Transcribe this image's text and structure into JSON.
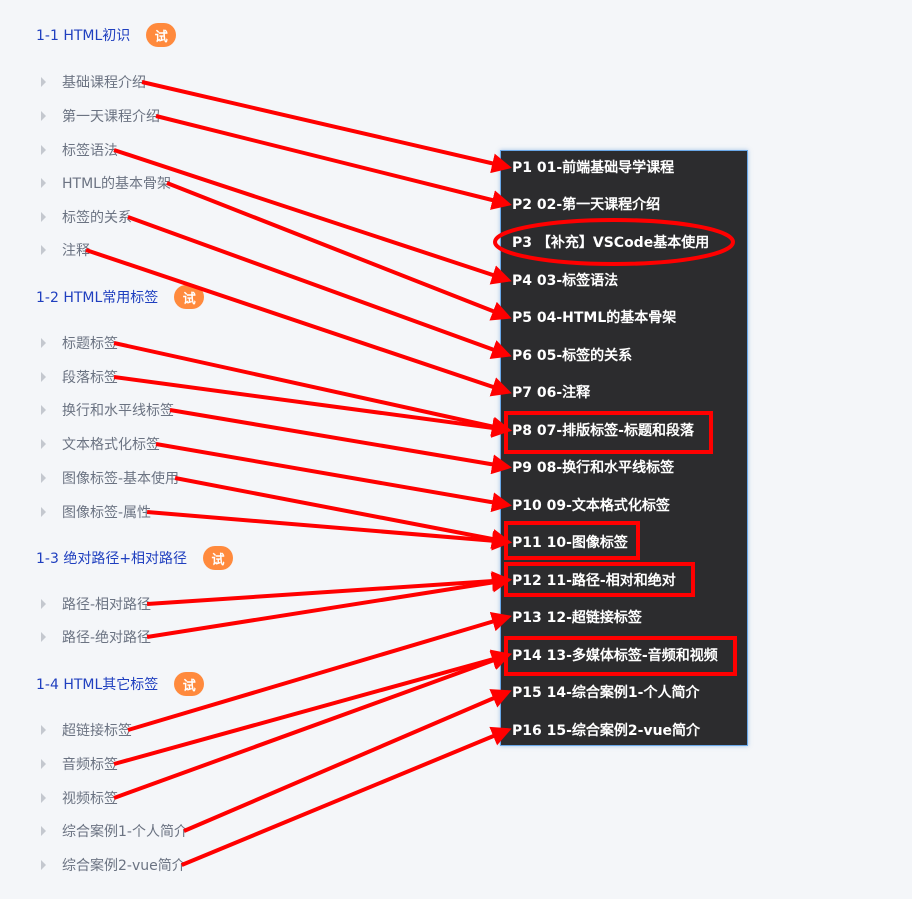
{
  "course_outline": {
    "trial_badge_label": "试",
    "sections": [
      {
        "title": "1-1 HTML初识",
        "lessons": [
          "基础课程介绍",
          "第一天课程介绍",
          "标签语法",
          "HTML的基本骨架",
          "标签的关系",
          "注释"
        ]
      },
      {
        "title": "1-2 HTML常用标签",
        "lessons": [
          "标题标签",
          "段落标签",
          "换行和水平线标签",
          "文本格式化标签",
          "图像标签-基本使用",
          "图像标签-属性"
        ]
      },
      {
        "title": "1-3 绝对路径+相对路径",
        "lessons": [
          "路径-相对路径",
          "路径-绝对路径"
        ]
      },
      {
        "title": "1-4 HTML其它标签",
        "lessons": [
          "超链接标签",
          "音频标签",
          "视频标签",
          "综合案例1-个人简介",
          "综合案例2-vue简介"
        ]
      }
    ]
  },
  "playlist": {
    "items": [
      "P1 01-前端基础导学课程",
      "P2 02-第一天课程介绍",
      "P3 【补充】VSCode基本使用",
      "P4 03-标签语法",
      "P5 04-HTML的基本骨架",
      "P6 05-标签的关系",
      "P7 06-注释",
      "P8 07-排版标签-标题和段落",
      "P9 08-换行和水平线标签",
      "P10 09-文本格式化标签",
      "P11 10-图像标签",
      "P12 11-路径-相对和绝对",
      "P13 12-超链接标签",
      "P14 13-多媒体标签-音频和视频",
      "P15 14-综合案例1-个人简介",
      "P16 15-综合案例2-vue简介"
    ]
  },
  "annotations": {
    "color": "#ff0000",
    "highlighted_items": [
      "P3 【补充】VSCode基本使用",
      "P8 07-排版标签-标题和段落",
      "P11 10-图像标签",
      "P12 11-路径-相对和绝对",
      "P14 13-多媒体标签-音频和视频"
    ],
    "arrows": [
      {
        "from": "基础课程介绍",
        "to": "P1 01-前端基础导学课程"
      },
      {
        "from": "第一天课程介绍",
        "to": "P2 02-第一天课程介绍"
      },
      {
        "from": "标签语法",
        "to": "P4 03-标签语法"
      },
      {
        "from": "HTML的基本骨架",
        "to": "P5 04-HTML的基本骨架"
      },
      {
        "from": "标签的关系",
        "to": "P6 05-标签的关系"
      },
      {
        "from": "注释",
        "to": "P7 06-注释"
      },
      {
        "from": "标题标签",
        "to": "P8 07-排版标签-标题和段落"
      },
      {
        "from": "段落标签",
        "to": "P8 07-排版标签-标题和段落"
      },
      {
        "from": "换行和水平线标签",
        "to": "P9 08-换行和水平线标签"
      },
      {
        "from": "文本格式化标签",
        "to": "P10 09-文本格式化标签"
      },
      {
        "from": "图像标签-基本使用",
        "to": "P11 10-图像标签"
      },
      {
        "from": "图像标签-属性",
        "to": "P11 10-图像标签"
      },
      {
        "from": "路径-相对路径",
        "to": "P12 11-路径-相对和绝对"
      },
      {
        "from": "路径-绝对路径",
        "to": "P12 11-路径-相对和绝对"
      },
      {
        "from": "超链接标签",
        "to": "P13 12-超链接标签"
      },
      {
        "from": "音频标签",
        "to": "P14 13-多媒体标签-音频和视频"
      },
      {
        "from": "视频标签",
        "to": "P14 13-多媒体标签-音频和视频"
      },
      {
        "from": "综合案例1-个人简介",
        "to": "P15 14-综合案例1-个人简介"
      },
      {
        "from": "综合案例2-vue简介",
        "to": "P16 15-综合案例2-vue简介"
      }
    ]
  }
}
